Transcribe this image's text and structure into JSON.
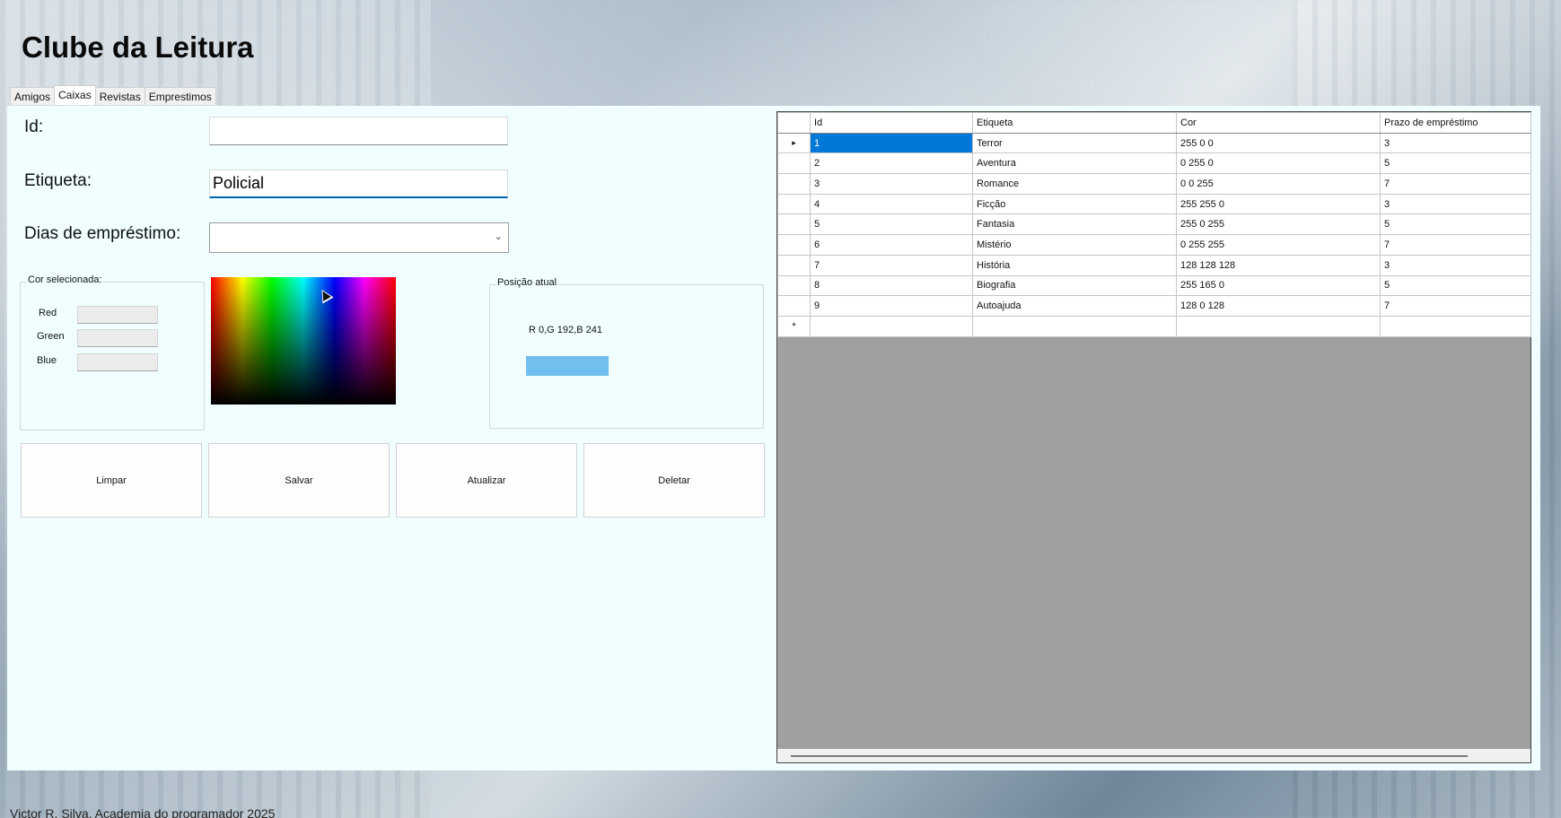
{
  "app": {
    "title": "Clube da Leitura"
  },
  "tabs": [
    {
      "label": "Amigos"
    },
    {
      "label": "Caixas"
    },
    {
      "label": "Revistas"
    },
    {
      "label": "Emprestimos"
    }
  ],
  "form": {
    "id_label": "Id:",
    "id_value": "",
    "etiqueta_label": "Etiqueta:",
    "etiqueta_value": "Policial",
    "dias_label": "Dias de empréstimo:",
    "dias_value": ""
  },
  "cor_group": {
    "legend": "Cor selecionada:",
    "red_label": "Red",
    "green_label": "Green",
    "blue_label": "Blue"
  },
  "posicao_group": {
    "legend": "Posição atual",
    "text": "R 0,G 192,B 241",
    "swatch_color": "#70bfef"
  },
  "buttons": {
    "limpar": "Limpar",
    "salvar": "Salvar",
    "atualizar": "Atualizar",
    "deletar": "Deletar"
  },
  "grid": {
    "columns": [
      "Id",
      "Etiqueta",
      "Cor",
      "Prazo de empréstimo"
    ],
    "rows": [
      [
        "1",
        "Terror",
        "255 0 0",
        "3"
      ],
      [
        "2",
        "Aventura",
        "0 255 0",
        "5"
      ],
      [
        "3",
        "Romance",
        "0 0 255",
        "7"
      ],
      [
        "4",
        "Ficção",
        "255 255 0",
        "3"
      ],
      [
        "5",
        "Fantasia",
        "255 0 255",
        "5"
      ],
      [
        "6",
        "Mistério",
        "0 255 255",
        "7"
      ],
      [
        "7",
        "História",
        "128 128 128",
        "3"
      ],
      [
        "8",
        "Biografia",
        "255 165 0",
        "5"
      ],
      [
        "9",
        "Autoajuda",
        "128 0 128",
        "7"
      ]
    ],
    "current_row_marker": "▸",
    "new_row_marker": "*"
  },
  "footer": {
    "text": "Victor R. Silva, Academia do programador 2025"
  },
  "colors": {
    "accent": "#0078d7",
    "panel_bg": "#f0feff"
  }
}
